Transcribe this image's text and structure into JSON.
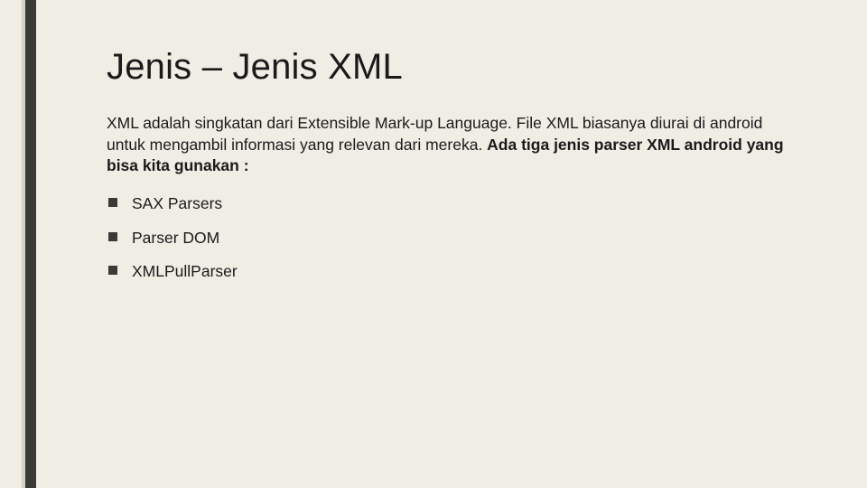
{
  "slide": {
    "title": "Jenis – Jenis XML",
    "body_plain": "XML adalah singkatan dari Extensible Mark-up Language. File XML biasanya diurai di android untuk mengambil informasi yang relevan dari mereka. ",
    "body_bold": "Ada tiga jenis parser XML android yang bisa kita gunakan :",
    "bullets": [
      "SAX Parsers",
      "Parser DOM",
      "XMLPullParser"
    ]
  }
}
